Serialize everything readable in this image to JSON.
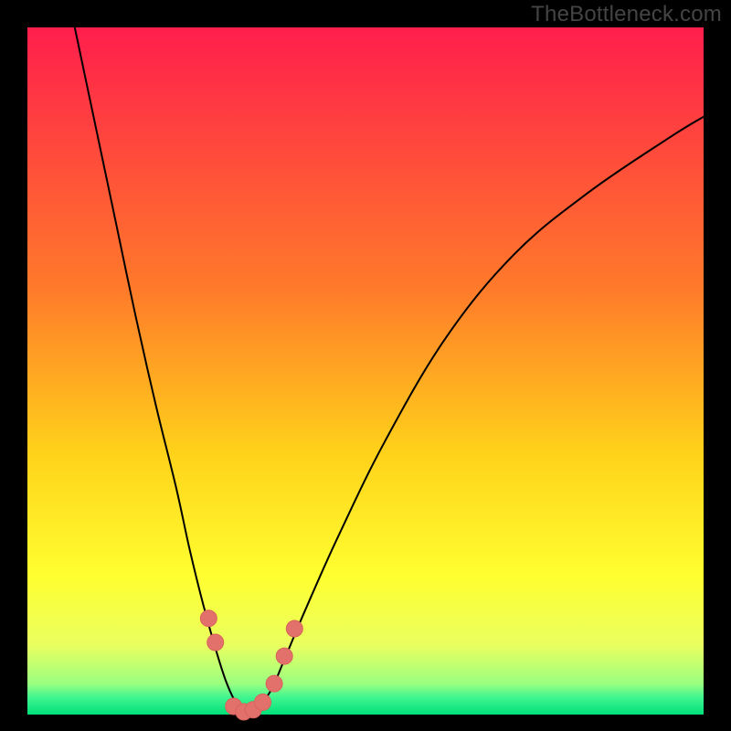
{
  "watermark": "TheBottleneck.com",
  "chart_data": {
    "type": "line",
    "title": "",
    "xlabel": "",
    "ylabel": "",
    "xlim": [
      0,
      100
    ],
    "ylim": [
      0,
      100
    ],
    "grid": false,
    "legend": false,
    "background": {
      "frame_color": "#000000",
      "gradient_stops": [
        {
          "pos": 0.0,
          "color": "#ff1e4c"
        },
        {
          "pos": 0.38,
          "color": "#ff7a2a"
        },
        {
          "pos": 0.62,
          "color": "#ffd21a"
        },
        {
          "pos": 0.8,
          "color": "#ffff30"
        },
        {
          "pos": 0.9,
          "color": "#e9ff60"
        },
        {
          "pos": 0.955,
          "color": "#9bff80"
        },
        {
          "pos": 0.975,
          "color": "#40f590"
        },
        {
          "pos": 1.0,
          "color": "#00e07a"
        }
      ]
    },
    "series": [
      {
        "name": "bottleneck-curve",
        "stroke": "#000000",
        "stroke_width": 2,
        "x": [
          7,
          10,
          13,
          16,
          19,
          22,
          24,
          26,
          28,
          29.5,
          31,
          32.5,
          34,
          36,
          38,
          41,
          46,
          53,
          62,
          72,
          83,
          95,
          100
        ],
        "y": [
          100,
          86,
          72,
          58,
          45,
          33,
          24,
          16,
          9,
          4.5,
          1.5,
          0.3,
          1.0,
          3.5,
          8,
          15,
          26,
          40,
          55,
          67,
          76,
          84,
          87
        ]
      }
    ],
    "curve_minimum_x": 32.5,
    "markers": {
      "color": "#e2716b",
      "radius": 9,
      "stroke": "#d9625c",
      "points": [
        {
          "x": 26.8,
          "y": 14.0
        },
        {
          "x": 27.8,
          "y": 10.5
        },
        {
          "x": 30.5,
          "y": 1.2
        },
        {
          "x": 32.0,
          "y": 0.4
        },
        {
          "x": 33.4,
          "y": 0.7
        },
        {
          "x": 34.8,
          "y": 1.8
        },
        {
          "x": 36.5,
          "y": 4.5
        },
        {
          "x": 38.0,
          "y": 8.5
        },
        {
          "x": 39.5,
          "y": 12.5
        }
      ]
    }
  }
}
